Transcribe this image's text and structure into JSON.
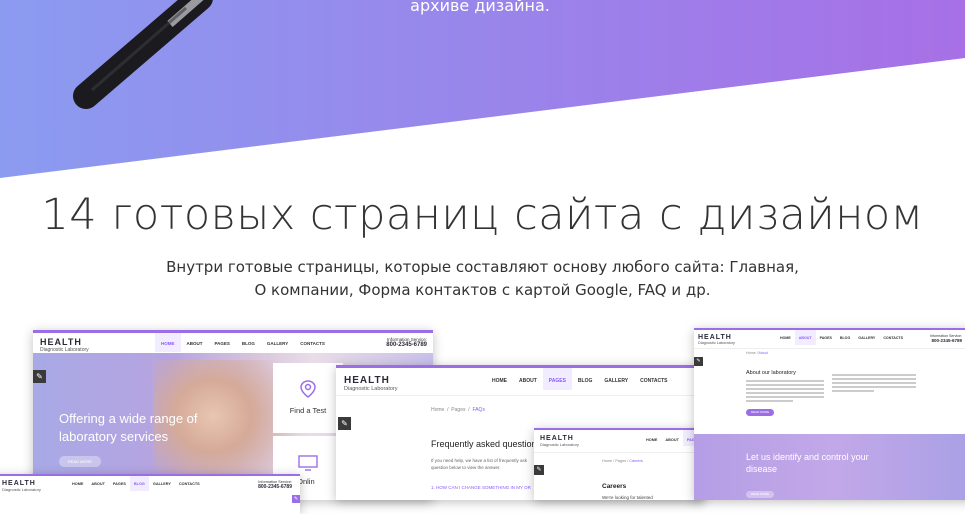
{
  "hero": {
    "tail_text": "архиве дизайна.",
    "colors": {
      "gradient_start": "#8b9bf0",
      "gradient_end": "#a770e6"
    }
  },
  "section": {
    "title": "14 готовых страниц сайта с дизайном",
    "subtitle_line1": "Внутри готовые страницы, которые составляют основу любого сайта: Главная,",
    "subtitle_line2": "О компании, Форма контактов с картой Google, FAQ и др."
  },
  "site": {
    "logo": "HEALTH",
    "logo_sub": "Diagnostic Laboratory",
    "info_label": "Information Service:",
    "info_phone": "800-2345-6789",
    "nav": [
      "HOME",
      "ABOUT",
      "PAGES",
      "BLOG",
      "GALLERY",
      "CONTACTS"
    ]
  },
  "home_page": {
    "headline_line1": "Offering a wide range of",
    "headline_line2": "laboratory services",
    "button": "READ MORE",
    "card_find_test": "Find a Test",
    "card_consult": "sult Onlin"
  },
  "faq_page": {
    "crumbs": [
      "Home",
      "Pages",
      "FAQs"
    ],
    "heading": "Frequently asked question",
    "intro_line1": "If you need help, we have a list of frequently ask",
    "intro_line2": "question below to view the answer.",
    "question1": "1. HOW CAN I CHANGE SOMETHING IN MY OR"
  },
  "careers_page": {
    "crumbs": [
      "Home",
      "Pages",
      "Careers"
    ],
    "heading": "Careers",
    "body": "We're looking for talented"
  },
  "about_page": {
    "crumbs": [
      "Home",
      "About"
    ],
    "heading": "About our laboratory",
    "button": "READ MORE",
    "banner_line1": "Let us identify and control your",
    "banner_line2": "disease",
    "banner_button": "READ MORE"
  }
}
